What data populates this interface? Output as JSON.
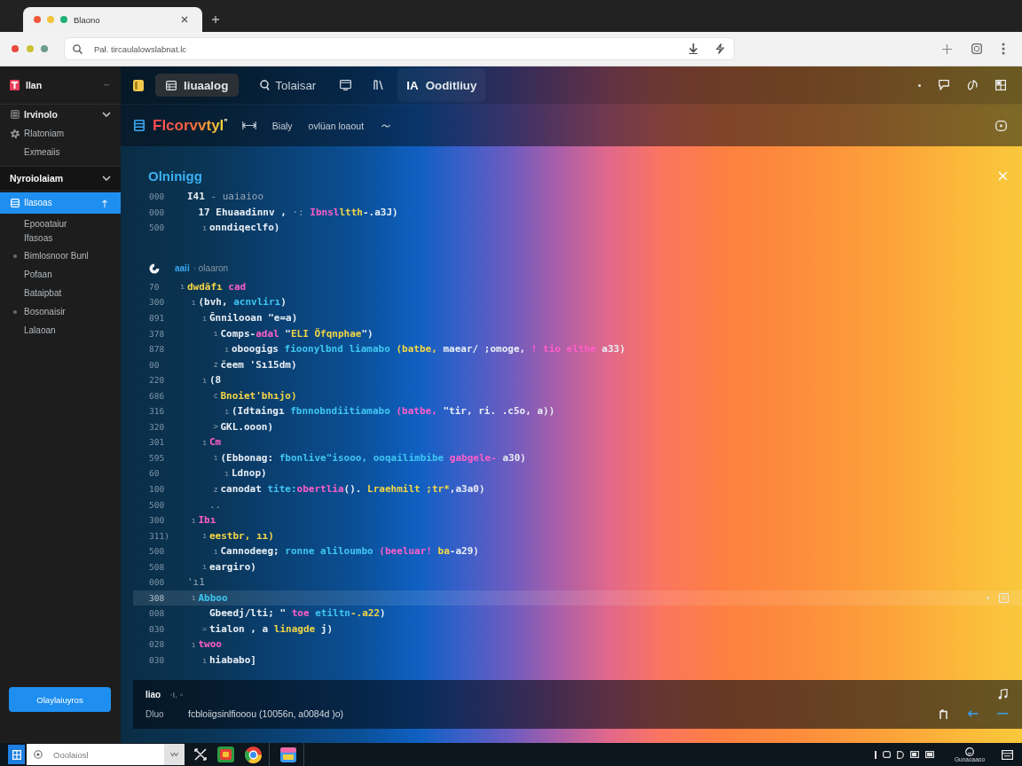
{
  "browser": {
    "tabs": [
      {
        "title": "Blaono",
        "selected": true
      }
    ],
    "address": {
      "url": "Pał. tircaulalowslabnat.lc"
    }
  },
  "sidebar": {
    "app": {
      "label": "Ilan"
    },
    "groups": [
      {
        "label": "Irvinolo",
        "kind": "icon",
        "expanded": true,
        "items": [
          {
            "label": "Rlatoniam",
            "kind": "icon",
            "selected": false
          },
          {
            "label": "Exmeaiis",
            "kind": "plain",
            "selected": false
          }
        ]
      },
      {
        "label": "Nyroiolaiam",
        "kind": "section",
        "expanded": true,
        "items": [
          {
            "label": "Ilasoas",
            "kind": "icon",
            "selected": true
          },
          {
            "label": "Epooataiur",
            "detail": "Ifasoas",
            "kind": "plain",
            "selected": false
          },
          {
            "label": "Bimlosnoor Bunl",
            "kind": "bullet",
            "selected": false
          },
          {
            "label": "Pofaan",
            "kind": "plain",
            "selected": false
          },
          {
            "label": "Bataipbat",
            "kind": "plain",
            "selected": false
          },
          {
            "label": "Bosonaisir",
            "kind": "bullet",
            "selected": false
          },
          {
            "label": "Lalaoan",
            "kind": "plain",
            "selected": false
          }
        ]
      }
    ],
    "button": "Olaylaiuyros"
  },
  "toolbar": {
    "tabs": [
      {
        "label": "Iiuaalog",
        "selected": true,
        "highlighted": false
      },
      {
        "label": "Tolaisar",
        "selected": false,
        "highlighted": false
      },
      {
        "prefix": "IA",
        "label": "Ooditliuy",
        "selected": false,
        "highlighted": true
      }
    ]
  },
  "document": {
    "title": "Flcorvvtyl$^{”}$",
    "items": [
      "Bialy",
      "ovlüan loaout"
    ]
  },
  "editor": {
    "heading": "Olninigg",
    "blocks": [
      {
        "lines": [
          {
            "num": "000",
            "tokens": [
              {
                "kind": "text",
                "text": "I41"
              },
              {
                "kind": "comment",
                "text": " - uaiaioo"
              }
            ],
            "current": false,
            "children": [
              {
                "num": "000",
                "tokens": [
                  {
                    "kind": "text",
                    "text": "17 Ehuaadinnv ,"
                  },
                  {
                    "kind": "comment",
                    "text": " ·: "
                  },
                  {
                    "kind": "keyword",
                    "text": "Ibnsl"
                  },
                  {
                    "kind": "string",
                    "text": "ltth"
                  },
                  {
                    "kind": "text",
                    "text": "-.a3J)"
                  }
                ],
                "current": false,
                "children": [
                  {
                    "num": "500",
                    "marker": "ı",
                    "tokens": [
                      {
                        "kind": "text",
                        "text": "onndiqeclfo)"
                      }
                    ],
                    "current": false
                  }
                ]
              }
            ]
          }
        ]
      },
      {
        "header": {
          "tag": "aaii",
          "text": "· olaaron"
        },
        "lines": [
          {
            "num": "70",
            "marker": "ı",
            "tokens": [
              {
                "kind": "string",
                "text": "dwdāfı"
              },
              {
                "kind": "keyword",
                "text": " cad"
              }
            ],
            "current": false,
            "children": [
              {
                "num": "300",
                "marker": "ı",
                "tokens": [
                  {
                    "kind": "text",
                    "text": "(bvh,"
                  },
                  {
                    "kind": "name",
                    "text": " acnvlirı"
                  },
                  {
                    "kind": "text",
                    "text": ")"
                  }
                ],
                "current": false,
                "children": [
                  {
                    "num": "891",
                    "marker": "ı",
                    "tokens": [
                      {
                        "kind": "text",
                        "text": "Ğnnilooan \"e=a)"
                      }
                    ],
                    "current": false,
                    "children": [
                      {
                        "num": "378",
                        "marker": "ı",
                        "tokens": [
                          {
                            "kind": "text",
                            "text": "Comps-"
                          },
                          {
                            "kind": "keyword",
                            "text": "adal"
                          },
                          {
                            "kind": "text",
                            "text": " \""
                          },
                          {
                            "kind": "string",
                            "text": "ELI Öfqnphae"
                          },
                          {
                            "kind": "text",
                            "text": "\")"
                          }
                        ],
                        "current": false,
                        "children": [
                          {
                            "num": "878",
                            "marker": "ı",
                            "tokens": [
                              {
                                "kind": "text",
                                "text": "oboogigs"
                              },
                              {
                                "kind": "name",
                                "text": " fioonylbnd liamabo"
                              },
                              {
                                "kind": "string",
                                "text": " (batbe,"
                              },
                              {
                                "kind": "text",
                                "text": " maear/ ;omoge,"
                              },
                              {
                                "kind": "keyword",
                                "text": " ! tio elthe"
                              },
                              {
                                "kind": "text",
                                "text": " a33)"
                              }
                            ],
                            "current": false
                          }
                        ]
                      },
                      {
                        "num": "00",
                        "marker": "z",
                        "tokens": [
                          {
                            "kind": "text",
                            "text": "čeem 'Sı15dm)"
                          }
                        ],
                        "current": false
                      }
                    ]
                  },
                  {
                    "num": "220",
                    "marker": "ı",
                    "tokens": [
                      {
                        "kind": "text",
                        "text": "(8"
                      }
                    ],
                    "current": false,
                    "children": [
                      {
                        "num": "686",
                        "marker": "c",
                        "tokens": [
                          {
                            "kind": "string",
                            "text": "Bnoiet'bhıjo)"
                          }
                        ],
                        "current": false,
                        "children": [
                          {
                            "num": "316",
                            "marker": "ı",
                            "tokens": [
                              {
                                "kind": "text",
                                "text": "(Idtaingı"
                              },
                              {
                                "kind": "name",
                                "text": " fbnnobndiitiamabo"
                              },
                              {
                                "kind": "keyword",
                                "text": " (batbe,"
                              },
                              {
                                "kind": "text",
                                "text": " \"tir, ri. .c5o, a))"
                              }
                            ],
                            "current": false
                          }
                        ]
                      },
                      {
                        "num": "320",
                        "marker": ">",
                        "tokens": [
                          {
                            "kind": "text",
                            "text": "GKL.ooon)"
                          }
                        ],
                        "current": false
                      }
                    ]
                  },
                  {
                    "num": "301",
                    "marker": "ı",
                    "tokens": [
                      {
                        "kind": "keyword",
                        "text": "Cm"
                      }
                    ],
                    "current": false,
                    "children": [
                      {
                        "num": "595",
                        "marker": "ı",
                        "tokens": [
                          {
                            "kind": "text",
                            "text": "(Ebbonag:"
                          },
                          {
                            "kind": "name",
                            "text": " fbonlive\"isooo, ooqailimbibe"
                          },
                          {
                            "kind": "keyword",
                            "text": " gabgele-"
                          },
                          {
                            "kind": "text",
                            "text": " a30)"
                          }
                        ],
                        "current": false,
                        "children": [
                          {
                            "num": "60",
                            "marker": "ı",
                            "tokens": [
                              {
                                "kind": "text",
                                "text": "Ldnop)"
                              }
                            ],
                            "current": false
                          }
                        ]
                      },
                      {
                        "num": "100",
                        "marker": "z",
                        "tokens": [
                          {
                            "kind": "text",
                            "text": "canodat"
                          },
                          {
                            "kind": "name",
                            "text": " tite:"
                          },
                          {
                            "kind": "keyword",
                            "text": "obertlia"
                          },
                          {
                            "kind": "text",
                            "text": "(). "
                          },
                          {
                            "kind": "string",
                            "text": "Lraehmilt ;tr*"
                          },
                          {
                            "kind": "text",
                            "text": ",a3a0)"
                          }
                        ],
                        "current": false
                      }
                    ]
                  },
                  {
                    "num": "500",
                    "tokens": [
                      {
                        "kind": "comment",
                        "text": ".."
                      }
                    ],
                    "current": false
                  }
                ]
              },
              {
                "num": "300",
                "marker": "ı",
                "tokens": [
                  {
                    "kind": "keyword",
                    "text": "Ibı"
                  }
                ],
                "current": false,
                "children": [
                  {
                    "num": "311)",
                    "marker": "ı",
                    "tokens": [
                      {
                        "kind": "string",
                        "text": "eestbr, ıı)"
                      }
                    ],
                    "current": false,
                    "children": [
                      {
                        "num": "500",
                        "marker": "ı",
                        "tokens": [
                          {
                            "kind": "text",
                            "text": "Cannodeeg;"
                          },
                          {
                            "kind": "name",
                            "text": " ronne aliloumbo"
                          },
                          {
                            "kind": "keyword",
                            "text": " (beeluar!"
                          },
                          {
                            "kind": "string",
                            "text": " ba"
                          },
                          {
                            "kind": "text",
                            "text": "-a29)"
                          }
                        ],
                        "current": false
                      }
                    ]
                  },
                  {
                    "num": "508",
                    "marker": "ı",
                    "tokens": [
                      {
                        "kind": "text",
                        "text": "eargiro)"
                      }
                    ],
                    "current": false
                  }
                ]
              }
            ]
          },
          {
            "num": "000",
            "tokens": [
              {
                "kind": "comment",
                "text": "'ı1"
              }
            ],
            "current": false,
            "children": [
              {
                "num": "308",
                "marker": "ı",
                "tokens": [
                  {
                    "kind": "name",
                    "text": "Abboo"
                  }
                ],
                "current": true,
                "children": [
                  {
                    "num": "008",
                    "tokens": [
                      {
                        "kind": "text",
                        "text": "Gbeedj/lti; \""
                      },
                      {
                        "kind": "keyword",
                        "text": " toe"
                      },
                      {
                        "kind": "name",
                        "text": " etiltn"
                      },
                      {
                        "kind": "string",
                        "text": "-.a22"
                      },
                      {
                        "kind": "text",
                        "text": ")"
                      }
                    ],
                    "current": false
                  },
                  {
                    "num": "030",
                    "marker": "=",
                    "tokens": [
                      {
                        "kind": "text",
                        "text": "tialon , a"
                      },
                      {
                        "kind": "string",
                        "text": " linagde"
                      },
                      {
                        "kind": "text",
                        "text": " j)"
                      }
                    ],
                    "current": false
                  }
                ]
              },
              {
                "num": "028",
                "marker": "ı",
                "tokens": [
                  {
                    "kind": "keyword",
                    "text": "twoo"
                  }
                ],
                "current": false,
                "children": [
                  {
                    "num": "030",
                    "marker": "ı",
                    "tokens": [
                      {
                        "kind": "text",
                        "text": "hiababo]"
                      }
                    ],
                    "current": false
                  }
                ]
              }
            ]
          }
        ]
      }
    ]
  },
  "footer": {
    "title": "Iiao",
    "meta": "·ı. ▫",
    "label": "Dluo",
    "value": "fcbloiigsinlfiooou (10056n, a0084d )o)"
  },
  "taskbar": {
    "search": {
      "placeholder": "Ooolaiosl"
    },
    "tray_label": "Gunaoaaoo"
  }
}
